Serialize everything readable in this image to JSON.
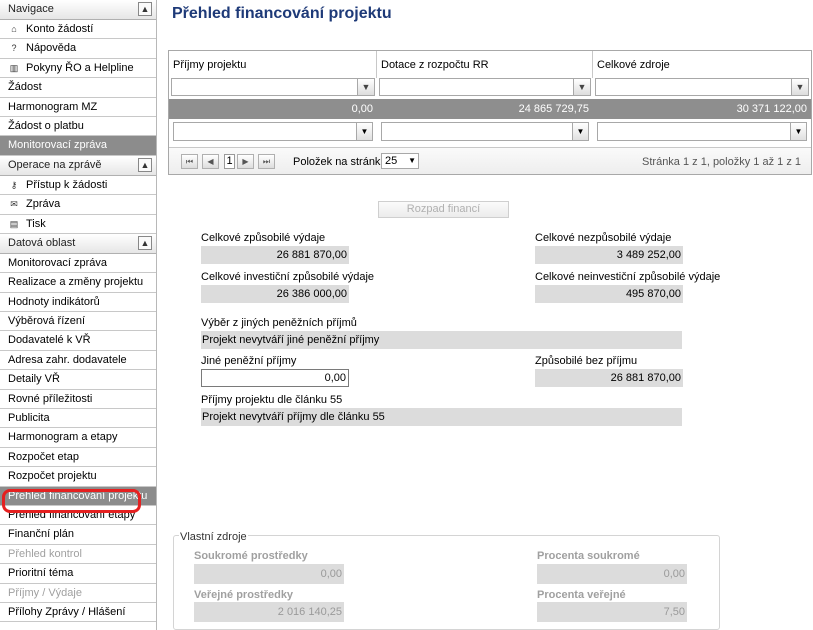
{
  "sidebar": {
    "navigace": {
      "header": "Navigace",
      "items": [
        {
          "label": "Konto žádostí",
          "icon": "home-icon"
        },
        {
          "label": "Nápověda",
          "icon": "question-icon"
        },
        {
          "label": "Pokyny ŘO a Helpline",
          "icon": "book-icon"
        },
        {
          "label": "Žádost"
        },
        {
          "label": "Harmonogram MZ"
        },
        {
          "label": "Žádost o platbu"
        },
        {
          "label": "Monitorovací zpráva",
          "active": true
        }
      ]
    },
    "operace": {
      "header": "Operace na zprávě",
      "items": [
        {
          "label": "Přístup k žádosti",
          "icon": "key-icon"
        },
        {
          "label": "Zpráva",
          "icon": "envelope-icon"
        },
        {
          "label": "Tisk",
          "icon": "print-icon"
        }
      ]
    },
    "datova": {
      "header": "Datová oblast",
      "items": [
        {
          "label": "Monitorovací zpráva"
        },
        {
          "label": "Realizace a změny projektu"
        },
        {
          "label": "Hodnoty indikátorů"
        },
        {
          "label": "Výběrová řízení"
        },
        {
          "label": "Dodavatelé k VŘ"
        },
        {
          "label": "Adresa zahr. dodavatele"
        },
        {
          "label": "Detaily VŘ"
        },
        {
          "label": "Rovné příležitosti"
        },
        {
          "label": "Publicita"
        },
        {
          "label": "Harmonogram a etapy"
        },
        {
          "label": "Rozpočet etap"
        },
        {
          "label": "Rozpočet projektu"
        },
        {
          "label": "Přehled financování projektu",
          "active": true
        },
        {
          "label": "Přehled financování etapy"
        },
        {
          "label": "Finanční plán"
        },
        {
          "label": "Přehled kontrol",
          "disabled": true
        },
        {
          "label": "Prioritní téma"
        },
        {
          "label": "Příjmy / Výdaje",
          "disabled": true
        },
        {
          "label": "Přílohy Zprávy / Hlášení"
        }
      ]
    },
    "collapse_glyph": "▲"
  },
  "page": {
    "title": "Přehled financování projektu"
  },
  "grid": {
    "columns": [
      "Příjmy projektu",
      "Dotace z rozpočtu RR",
      "Celkové zdroje"
    ],
    "totals": [
      "0,00",
      "24 865 729,75",
      "30 371 122,00"
    ],
    "filter_icon": "funnel-icon",
    "pager": {
      "first": "⏮",
      "prev": "◀",
      "next": "▶",
      "last": "⏭",
      "current_page": "1",
      "page_size_label": "Položek na stránku",
      "page_size": "25",
      "info": "Stránka 1 z 1, položky 1 až 1 z 1"
    }
  },
  "rozpad_button": "Rozpad financí",
  "fields": {
    "celkove_zpusobile_label": "Celkové způsobilé výdaje",
    "celkove_zpusobile_value": "26 881 870,00",
    "celkove_nezpusobile_label": "Celkové nezpůsobilé výdaje",
    "celkove_nezpusobile_value": "3 489 252,00",
    "investicni_label": "Celkové investiční způsobilé výdaje",
    "investicni_value": "26 386 000,00",
    "neinvesticni_label": "Celkové neinvestiční způsobilé výdaje",
    "neinvesticni_value": "495 870,00",
    "vyber_label": "Výběr z jiných peněžních příjmů",
    "vyber_value": "Projekt nevytváří jiné peněžní příjmy",
    "jine_label": "Jiné peněžní příjmy",
    "jine_value": "0,00",
    "bez_prijmu_label": "Způsobilé bez příjmu",
    "bez_prijmu_value": "26 881 870,00",
    "cl55_label": "Příjmy projektu dle článku 55",
    "cl55_value": "Projekt nevytváří příjmy dle článku 55"
  },
  "vlastni": {
    "legend": "Vlastní zdroje",
    "soukrome_label": "Soukromé prostředky",
    "soukrome_value": "0,00",
    "procenta_soukrome_label": "Procenta soukromé",
    "procenta_soukrome_value": "0,00",
    "verejne_label": "Veřejné prostředky",
    "verejne_value": "2 016 140,25",
    "procenta_verejne_label": "Procenta veřejné",
    "procenta_verejne_value": "7,50"
  }
}
